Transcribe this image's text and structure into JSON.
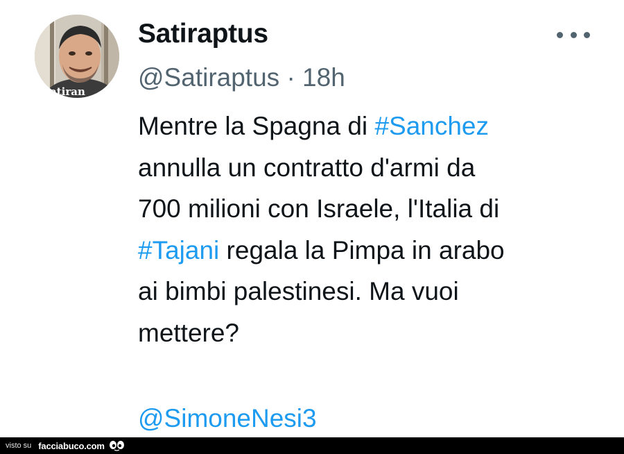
{
  "tweet": {
    "display_name": "Satiraptus",
    "handle": "@Satiraptus",
    "separator": "·",
    "time": "18h",
    "avatar_text": "atiran",
    "more_icon": "more-horizontal-icon",
    "body": {
      "l1_a": "Mentre la Spagna di ",
      "l1_tag": "#Sanchez",
      "l2": "annulla un contratto d'armi da",
      "l3": "700 milioni con Israele, l'Italia di",
      "l4_tag": "#Tajani",
      "l4_b": " regala la Pimpa in arabo",
      "l5": "ai bimbi palestinesi. Ma vuoi",
      "l6": "mettere?"
    },
    "mention": "@SimoneNesi3"
  },
  "footer": {
    "visto_su": "visto su",
    "site": "facciabuco.com"
  },
  "colors": {
    "link": "#1d9bf0",
    "text": "#0f1419",
    "secondary": "#536471",
    "footer_bg": "#000000"
  }
}
